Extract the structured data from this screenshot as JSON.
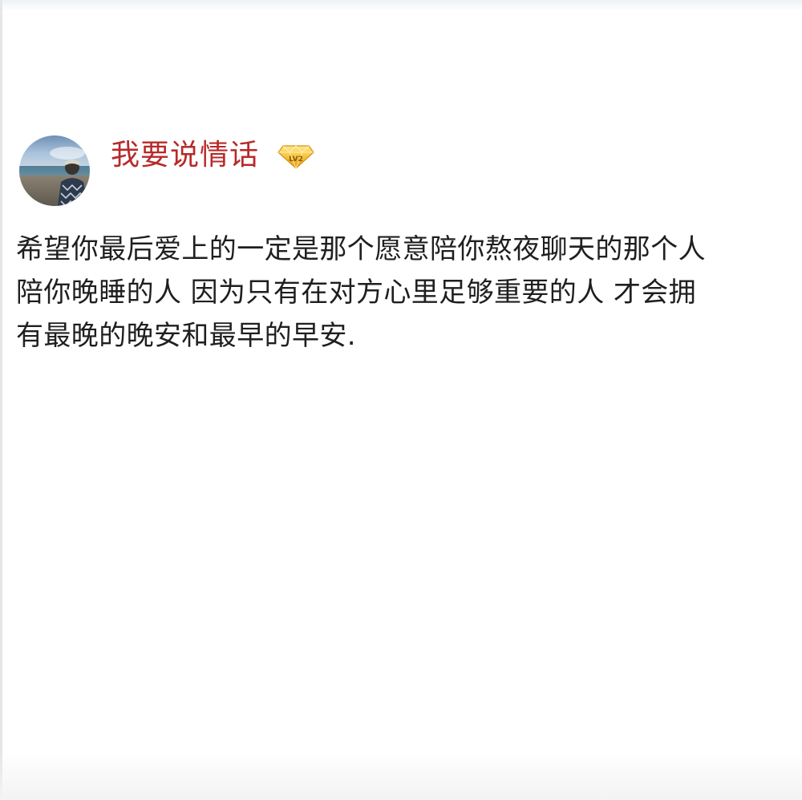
{
  "post": {
    "author": {
      "name": "我要说情话",
      "avatar_icon": "avatar-photo",
      "level_badge_icon": "diamond-level-badge-icon",
      "level_badge_text": "LV2",
      "name_color": "#b72a2a"
    },
    "text": "希望你最后爱上的一定是那个愿意陪你熬夜聊天的那个人\n陪你晚睡的人 因为只有在对方心里足够重要的人 才会拥\n有最晚的晚安和最早的早安."
  }
}
